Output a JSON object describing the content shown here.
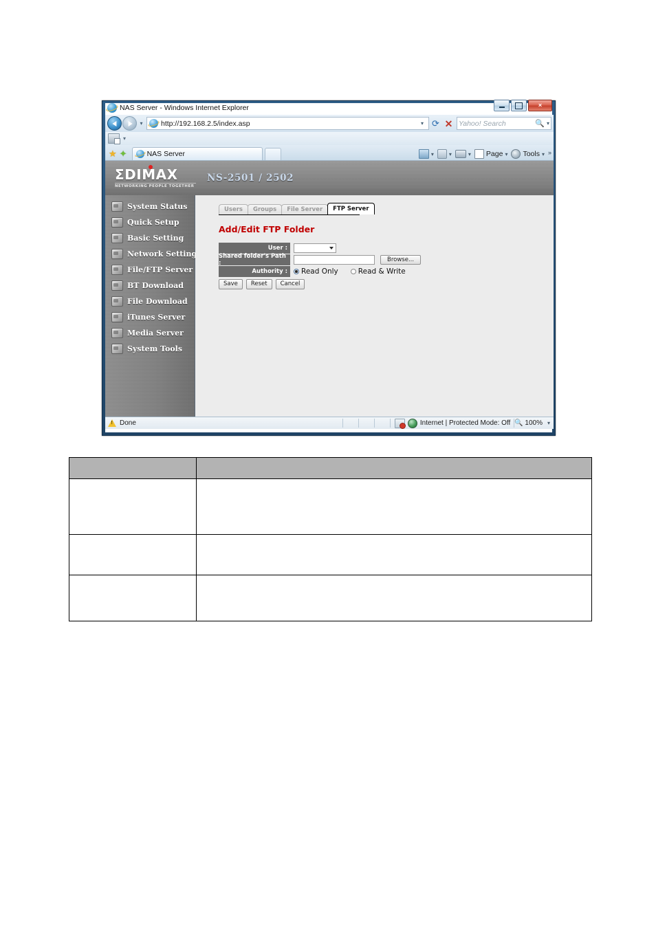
{
  "browser": {
    "title": "NAS Server - Windows Internet Explorer",
    "title_icon": "ie-icon",
    "window_buttons": {
      "minimize": "minimize-icon",
      "maximize": "maximize-icon",
      "close": "×"
    },
    "address": "http://192.168.2.5/index.asp",
    "address_icon": "page-favicon-icon",
    "address_dropdown_icon": "chevron-down-icon",
    "refresh_icon": "refresh-icon",
    "stop_icon": "stop-icon",
    "back_icon": "back-arrow-icon",
    "forward_icon": "forward-arrow-icon",
    "recent_pages_icon": "chevron-down-icon",
    "search_placeholder": "Yahoo! Search",
    "search_icon": "magnifier-icon",
    "search_provider_caret": "chevron-down-icon",
    "command_bar_icon": "page-tools-icon",
    "favorites_star_icon": "star-icon",
    "add_favorite_icon": "star-plus-icon",
    "tab": {
      "label": "NAS Server",
      "icon": "ie-tab-icon"
    },
    "new_tab_label": "",
    "toolbar_right": [
      {
        "name": "home-icon",
        "label": "",
        "caret": "▾"
      },
      {
        "name": "feeds-icon",
        "label": "",
        "caret": "▾"
      },
      {
        "name": "print-icon",
        "label": "",
        "caret": "▾"
      },
      {
        "name": "page-menu",
        "label": "Page",
        "caret": "▾"
      },
      {
        "name": "tools-menu",
        "label": "Tools",
        "caret": "▾"
      }
    ],
    "overflow_icon": "»"
  },
  "status_bar": {
    "warning_icon": "warning-icon",
    "status_text": "Done",
    "zone_icon": "restricted-sites-icon",
    "globe_icon": "internet-globe-icon",
    "zone_text": "Internet | Protected Mode: Off",
    "zoom_icon": "magnifier-icon",
    "zoom_level": "100%",
    "zoom_caret": "▾"
  },
  "nas": {
    "brand": "ΣDIMAX",
    "brand_tagline": "NETWORKING PEOPLE TOGETHER",
    "model": "NS-2501 / 2502",
    "sidebar": [
      {
        "label": "System Status",
        "icon": "system-status-icon"
      },
      {
        "label": "Quick Setup",
        "icon": "quick-setup-icon"
      },
      {
        "label": "Basic Setting",
        "icon": "basic-setting-icon"
      },
      {
        "label": "Network Setting",
        "icon": "network-setting-icon"
      },
      {
        "label": "File/FTP Server",
        "icon": "file-ftp-server-icon"
      },
      {
        "label": "BT Download",
        "icon": "bt-download-icon"
      },
      {
        "label": "File Download",
        "icon": "file-download-icon"
      },
      {
        "label": "iTunes Server",
        "icon": "itunes-server-icon"
      },
      {
        "label": "Media Server",
        "icon": "media-server-icon"
      },
      {
        "label": "System Tools",
        "icon": "system-tools-icon"
      }
    ],
    "tabs": [
      {
        "label": "Users",
        "active": false
      },
      {
        "label": "Groups",
        "active": false
      },
      {
        "label": "File Server",
        "active": false
      },
      {
        "label": "FTP Server",
        "active": true
      }
    ],
    "page_title": "Add/Edit FTP Folder",
    "page_title_color": "#c00000",
    "form": {
      "user_label": "User :",
      "user_value": "",
      "user_caret_icon": "chevron-down-icon",
      "path_label": "Shared folder's Path :",
      "path_value": "",
      "browse_label": "Browse...",
      "authority_label": "Authority :",
      "authority_options": [
        {
          "label": "Read Only",
          "selected": true
        },
        {
          "label": "Read & Write",
          "selected": false
        }
      ],
      "save_label": "Save",
      "reset_label": "Reset",
      "cancel_label": "Cancel"
    }
  },
  "doc_table": {
    "header": [
      "",
      ""
    ],
    "rows": [
      [
        "",
        ""
      ],
      [
        "",
        ""
      ],
      [
        "",
        ""
      ]
    ]
  }
}
